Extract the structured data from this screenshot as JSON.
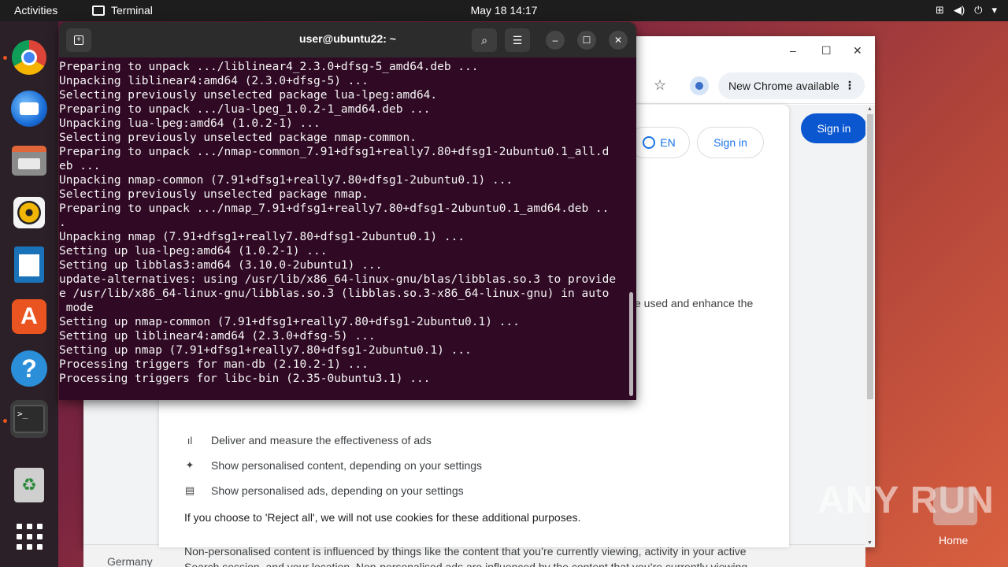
{
  "topbar": {
    "activities": "Activities",
    "app_name": "Terminal",
    "clock": "May 18  14:17",
    "tray_icons": [
      "network-icon",
      "volume-icon",
      "power-icon",
      "menu-arrow-icon"
    ]
  },
  "dock": {
    "items": [
      "Google Chrome",
      "Thunderbird Mail",
      "Files",
      "Rhythmbox",
      "LibreOffice Writer",
      "Ubuntu Software",
      "Help",
      "Terminal",
      "Trash",
      "Show Applications"
    ]
  },
  "chrome": {
    "new_chrome_label": "New Chrome available",
    "signin_top": "Sign in",
    "lang_label": "EN",
    "signin_dialog": "Sign in",
    "fragment_used": "e used and enhance the",
    "row_ads_measure": "Deliver and measure the effectiveness of ads",
    "row_personalised_content": "Show personalised content, depending on your settings",
    "row_personalised_ads": "Show personalised ads, depending on your settings",
    "reject_all_text": "If you choose to 'Reject all', we will not use cookies for these additional purposes.",
    "nonpersonalised_text": "Non-personalised content is influenced by things like the content that you’re currently viewing, activity in your active Search session, and your location. Non-personalised ads are influenced by the content that you’re currently viewing and your general location. Personalised content and ads can also include more relevant results,",
    "footer_country": "Germany"
  },
  "terminal": {
    "title": "user@ubuntu22: ~",
    "lines": [
      "Preparing to unpack .../liblinear4_2.3.0+dfsg-5_amd64.deb ...",
      "Unpacking liblinear4:amd64 (2.3.0+dfsg-5) ...",
      "Selecting previously unselected package lua-lpeg:amd64.",
      "Preparing to unpack .../lua-lpeg_1.0.2-1_amd64.deb ...",
      "Unpacking lua-lpeg:amd64 (1.0.2-1) ...",
      "Selecting previously unselected package nmap-common.",
      "Preparing to unpack .../nmap-common_7.91+dfsg1+really7.80+dfsg1-2ubuntu0.1_all.d",
      "eb ...",
      "Unpacking nmap-common (7.91+dfsg1+really7.80+dfsg1-2ubuntu0.1) ...",
      "Selecting previously unselected package nmap.",
      "Preparing to unpack .../nmap_7.91+dfsg1+really7.80+dfsg1-2ubuntu0.1_amd64.deb ..",
      ".",
      "Unpacking nmap (7.91+dfsg1+really7.80+dfsg1-2ubuntu0.1) ...",
      "Setting up lua-lpeg:amd64 (1.0.2-1) ...",
      "Setting up libblas3:amd64 (3.10.0-2ubuntu1) ...",
      "update-alternatives: using /usr/lib/x86_64-linux-gnu/blas/libblas.so.3 to provide",
      "e /usr/lib/x86_64-linux-gnu/libblas.so.3 (libblas.so.3-x86_64-linux-gnu) in auto",
      " mode",
      "Setting up nmap-common (7.91+dfsg1+really7.80+dfsg1-2ubuntu0.1) ...",
      "Setting up liblinear4:amd64 (2.3.0+dfsg-5) ...",
      "Setting up nmap (7.91+dfsg1+really7.80+dfsg1-2ubuntu0.1) ...",
      "Processing triggers for man-db (2.10.2-1) ...",
      "Processing triggers for libc-bin (2.35-0ubuntu3.1) ..."
    ]
  },
  "watermark": "ANY RUN",
  "desktop": {
    "home_label": "Home"
  },
  "colors": {
    "terminal_bg": "#300a24",
    "ubuntu_orange": "#e95420",
    "google_blue": "#1a73e8"
  }
}
